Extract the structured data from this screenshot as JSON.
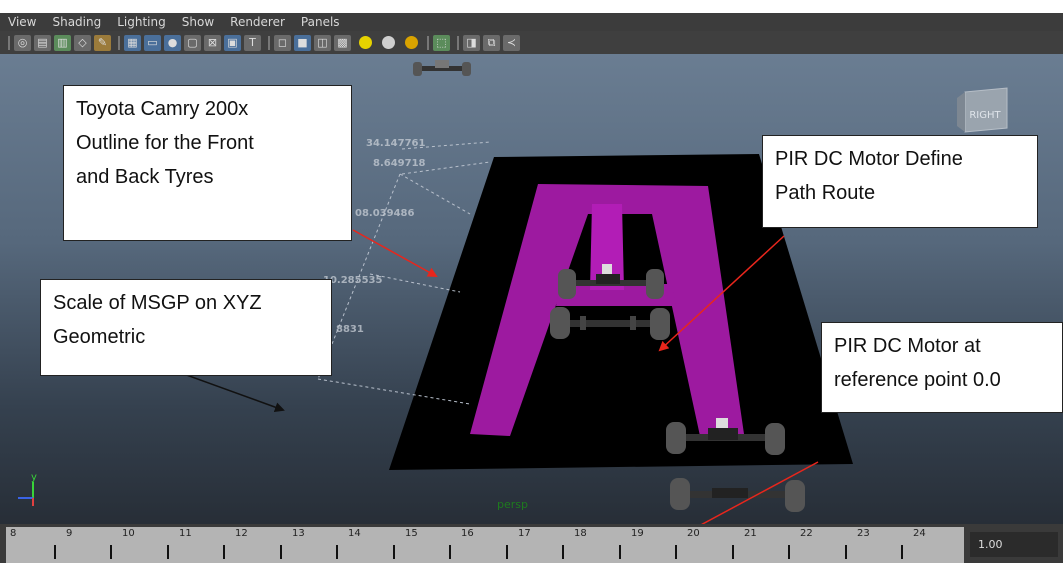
{
  "menubar": [
    "View",
    "Shading",
    "Lighting",
    "Show",
    "Renderer",
    "Panels"
  ],
  "viewcube_label": "RIGHT",
  "camera_label": "persp",
  "dimension_labels": [
    "34.147761",
    "8.649718",
    "08.039486",
    "10.285535",
    "8831"
  ],
  "callouts": {
    "toyota": [
      "Toyota Camry 200x",
      "Outline for the Front",
      "and Back Tyres"
    ],
    "scale": [
      "Scale of MSGP on XYZ",
      "Geometric"
    ],
    "pir_path": [
      "PIR DC Motor Define",
      "Path Route"
    ],
    "pir_ref": [
      "PIR DC Motor at",
      "reference point 0.0"
    ]
  },
  "timeline": {
    "labels": [
      "8",
      "9",
      "10",
      "11",
      "12",
      "13",
      "14",
      "15",
      "16",
      "17",
      "18",
      "19",
      "20",
      "21",
      "22",
      "23",
      "24"
    ],
    "current_frame": "1.00"
  },
  "colors": {
    "track": "#9d1aa0",
    "platform": "#000000",
    "arrow": "#e8261c"
  },
  "axis_labels": [
    "y"
  ]
}
